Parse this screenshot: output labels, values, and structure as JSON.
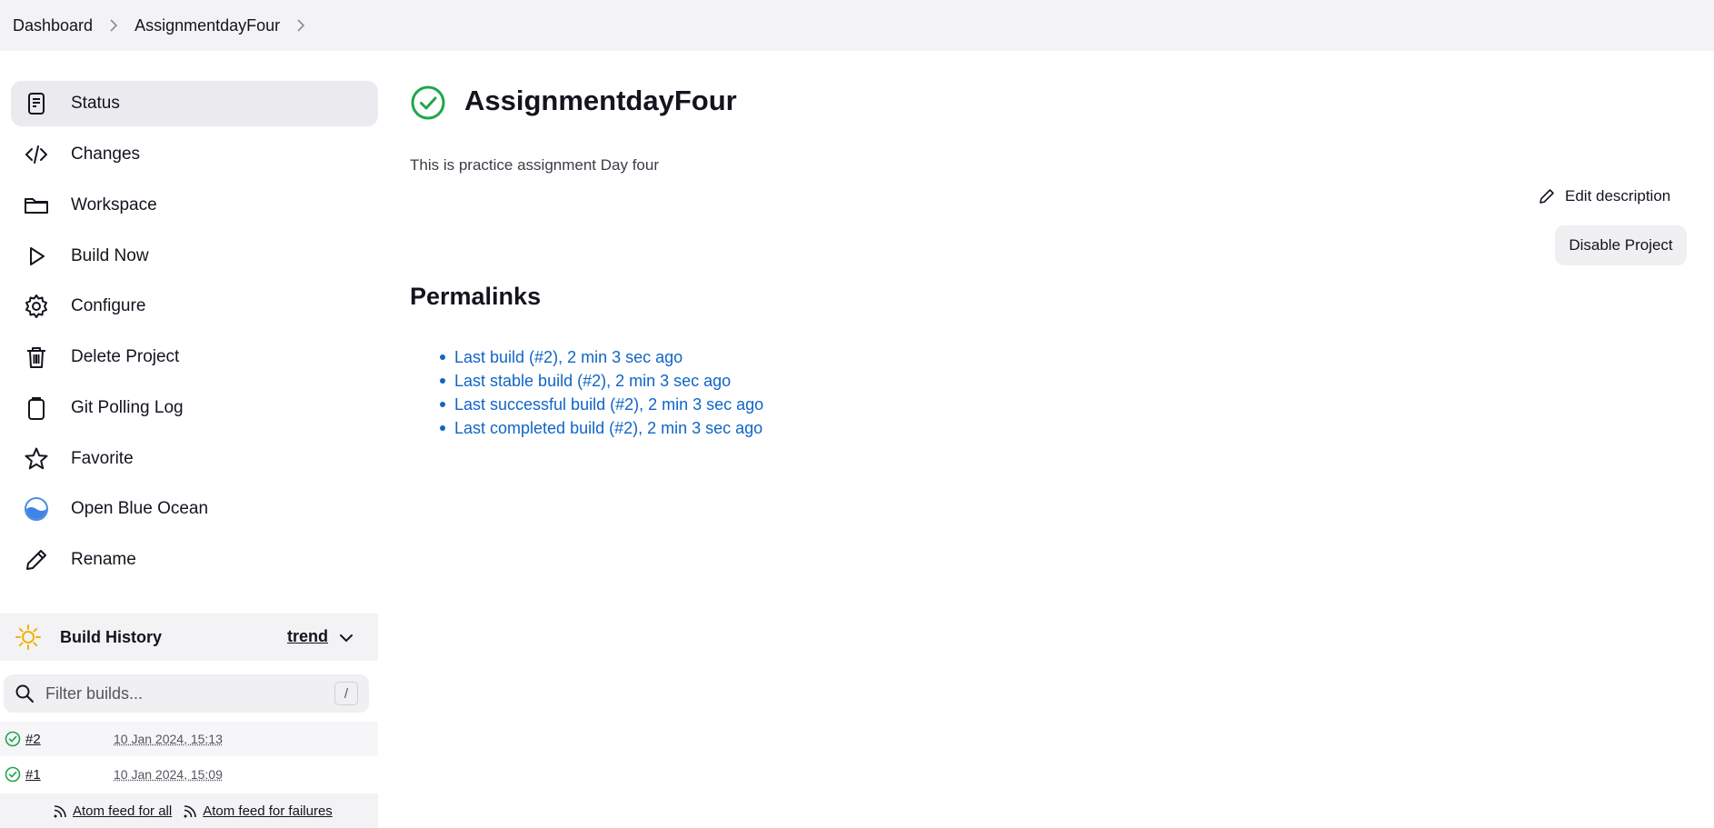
{
  "breadcrumb": {
    "items": [
      "Dashboard",
      "AssignmentdayFour"
    ]
  },
  "sidebar": {
    "items": [
      {
        "label": "Status",
        "icon": "document-icon"
      },
      {
        "label": "Changes",
        "icon": "code-icon"
      },
      {
        "label": "Workspace",
        "icon": "folder-icon"
      },
      {
        "label": "Build Now",
        "icon": "play-icon"
      },
      {
        "label": "Configure",
        "icon": "gear-icon"
      },
      {
        "label": "Delete Project",
        "icon": "trash-icon"
      },
      {
        "label": "Git Polling Log",
        "icon": "clipboard-icon"
      },
      {
        "label": "Favorite",
        "icon": "star-icon"
      },
      {
        "label": "Open Blue Ocean",
        "icon": "blue-ocean-icon"
      },
      {
        "label": "Rename",
        "icon": "pencil-icon"
      }
    ]
  },
  "build_history": {
    "title": "Build History",
    "trend_label": "trend",
    "filter_placeholder": "Filter builds...",
    "filter_shortcut": "/",
    "builds": [
      {
        "number": "#2",
        "date": "10 Jan 2024, 15:13",
        "status": "success"
      },
      {
        "number": "#1",
        "date": "10 Jan 2024, 15:09",
        "status": "success"
      }
    ],
    "feeds": {
      "all": "Atom feed for all",
      "failures": "Atom feed for failures"
    }
  },
  "main": {
    "title": "AssignmentdayFour",
    "description": "This is practice assignment Day four",
    "edit_description_label": "Edit description",
    "disable_button_label": "Disable Project",
    "permalinks_title": "Permalinks",
    "permalinks": [
      "Last build (#2), 2 min 3 sec ago",
      "Last stable build (#2), 2 min 3 sec ago",
      "Last successful build (#2), 2 min 3 sec ago",
      "Last completed build (#2), 2 min 3 sec ago"
    ]
  },
  "colors": {
    "link": "#1065c6",
    "success": "#1ea64b",
    "sun": "#f2b200",
    "active_bg": "#eaeaef"
  }
}
